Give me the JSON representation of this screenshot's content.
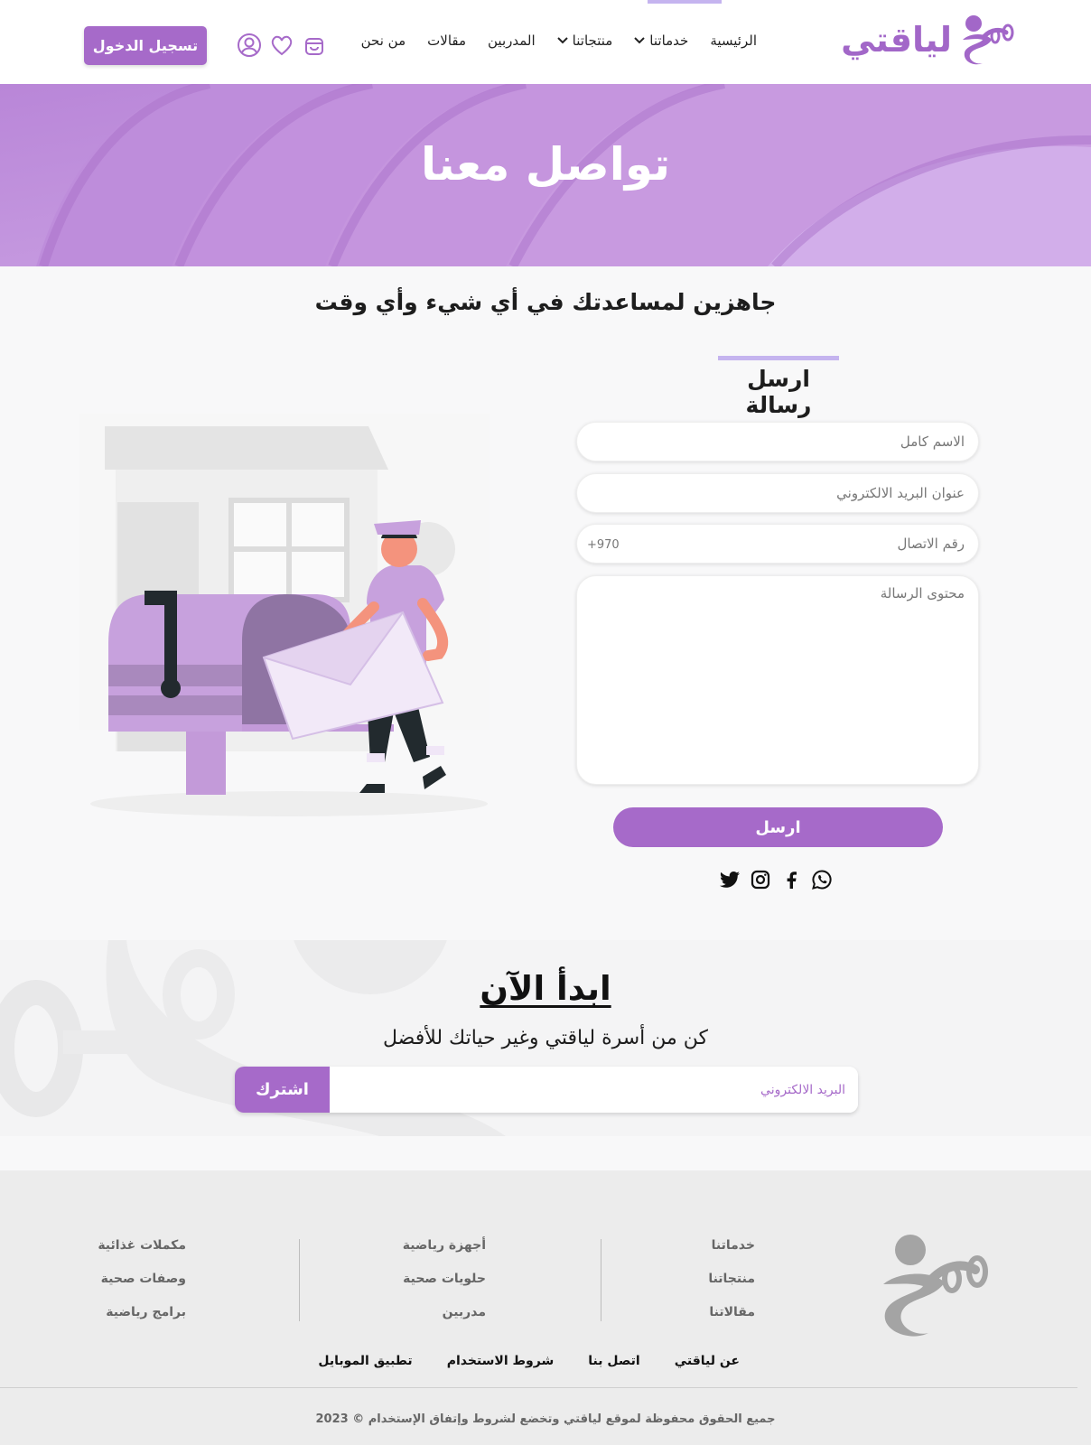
{
  "header": {
    "logo_text": "لياقتي",
    "nav": [
      {
        "label": "الرئيسية",
        "dropdown": false
      },
      {
        "label": "خدماتنا",
        "dropdown": true
      },
      {
        "label": "منتجاتنا",
        "dropdown": true
      },
      {
        "label": "المدربين",
        "dropdown": false
      },
      {
        "label": "مقالات",
        "dropdown": false
      },
      {
        "label": "من نحن",
        "dropdown": false
      }
    ],
    "icons": [
      "user-icon",
      "heart-icon",
      "cart-icon"
    ],
    "login_label": "تسجيل الدخول"
  },
  "hero": {
    "title": "تواصل معنا"
  },
  "contact": {
    "heading": "جاهزين لمساعدتك في أي شيء وأي وقت",
    "form_title": "ارسل رسالة",
    "name_placeholder": "الاسم كامل",
    "email_placeholder": "عنوان البريد الالكتروني",
    "phone_placeholder": "رقم الاتصال",
    "phone_prefix": "+970",
    "message_placeholder": "محتوى الرسالة",
    "send_label": "ارسل",
    "socials": [
      "whatsapp-icon",
      "facebook-icon",
      "instagram-icon",
      "twitter-icon"
    ]
  },
  "start": {
    "title": "ابدأ الآن",
    "subtitle": "كن من أسرة لياقتي وغير حياتك للأفضل",
    "email_placeholder": "البريد الالكتروني",
    "subscribe_label": "اشترك"
  },
  "footer": {
    "col1": [
      "خدماتنا",
      "منتجاتنا",
      "مقالاتنا"
    ],
    "col2": [
      "أجهزة رياضية",
      "حلويات صحية",
      "مدربين"
    ],
    "col3": [
      "مكملات غذائية",
      "وصفات صحية",
      "برامج رياضية"
    ],
    "bottom_links": [
      "عن لياقتي",
      "اتصل بنا",
      "شروط الاستخدام",
      "تطبيق الموبايل"
    ],
    "copyright": "جميع الحقوق محفوظة لموقع لياقتي وتخضع لشروط وإتفاق الإستخدام © 2023"
  },
  "colors": {
    "accent": "#a66ac9",
    "accent_light": "#c5b4ef",
    "hero_bg": "#c9a0e0"
  }
}
